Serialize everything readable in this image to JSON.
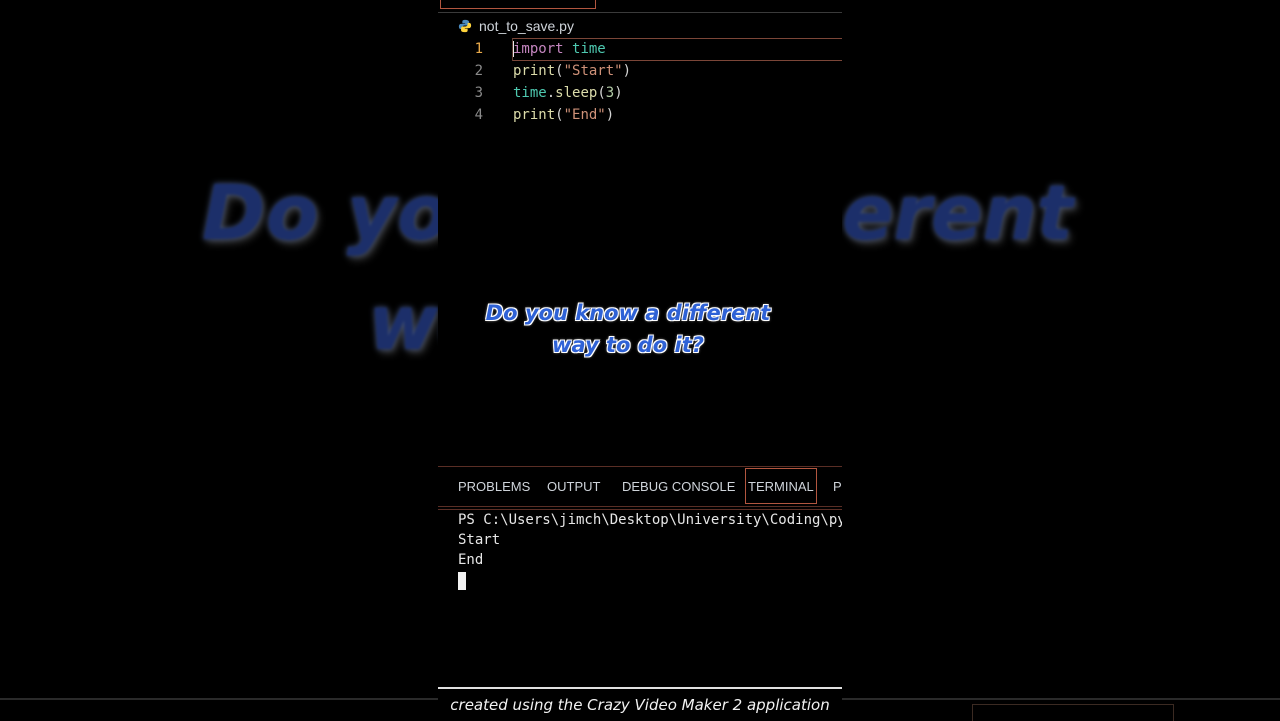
{
  "editor": {
    "file_tab": {
      "name": "not_to_save.py",
      "icon": "python-icon"
    },
    "lines": [
      {
        "number": "1",
        "tokens": [
          {
            "t": "import",
            "c": "kw"
          },
          {
            "t": " ",
            "c": ""
          },
          {
            "t": "time",
            "c": "id"
          }
        ]
      },
      {
        "number": "2",
        "tokens": [
          {
            "t": "print",
            "c": "fn"
          },
          {
            "t": "(",
            "c": ""
          },
          {
            "t": "\"Start\"",
            "c": "str"
          },
          {
            "t": ")",
            "c": ""
          }
        ]
      },
      {
        "number": "3",
        "tokens": [
          {
            "t": "time",
            "c": "id"
          },
          {
            "t": ".",
            "c": ""
          },
          {
            "t": "sleep",
            "c": "fn"
          },
          {
            "t": "(",
            "c": ""
          },
          {
            "t": "3",
            "c": "num"
          },
          {
            "t": ")",
            "c": ""
          }
        ]
      },
      {
        "number": "4",
        "tokens": [
          {
            "t": "print",
            "c": "fn"
          },
          {
            "t": "(",
            "c": ""
          },
          {
            "t": "\"End\"",
            "c": "str"
          },
          {
            "t": ")",
            "c": ""
          }
        ]
      }
    ]
  },
  "overlay": {
    "caption_line1": "Do you know a different",
    "caption_line2": "way to do it?",
    "background_left1": "Do you",
    "background_left2": "wo",
    "background_right": "erent"
  },
  "panel_tabs": {
    "problems": "PROBLEMS",
    "output": "OUTPUT",
    "debug_console": "DEBUG CONSOLE",
    "terminal": "TERMINAL",
    "ports": "P"
  },
  "terminal": {
    "prompt": "PS C:\\Users\\jimch\\Desktop\\University\\Coding\\py",
    "output": [
      "Start",
      "End"
    ]
  },
  "footer": {
    "text": "created using the Crazy Video Maker 2 application"
  },
  "colors": {
    "accent_border": "#b2563f",
    "caption_blue": "#2f62d6"
  }
}
